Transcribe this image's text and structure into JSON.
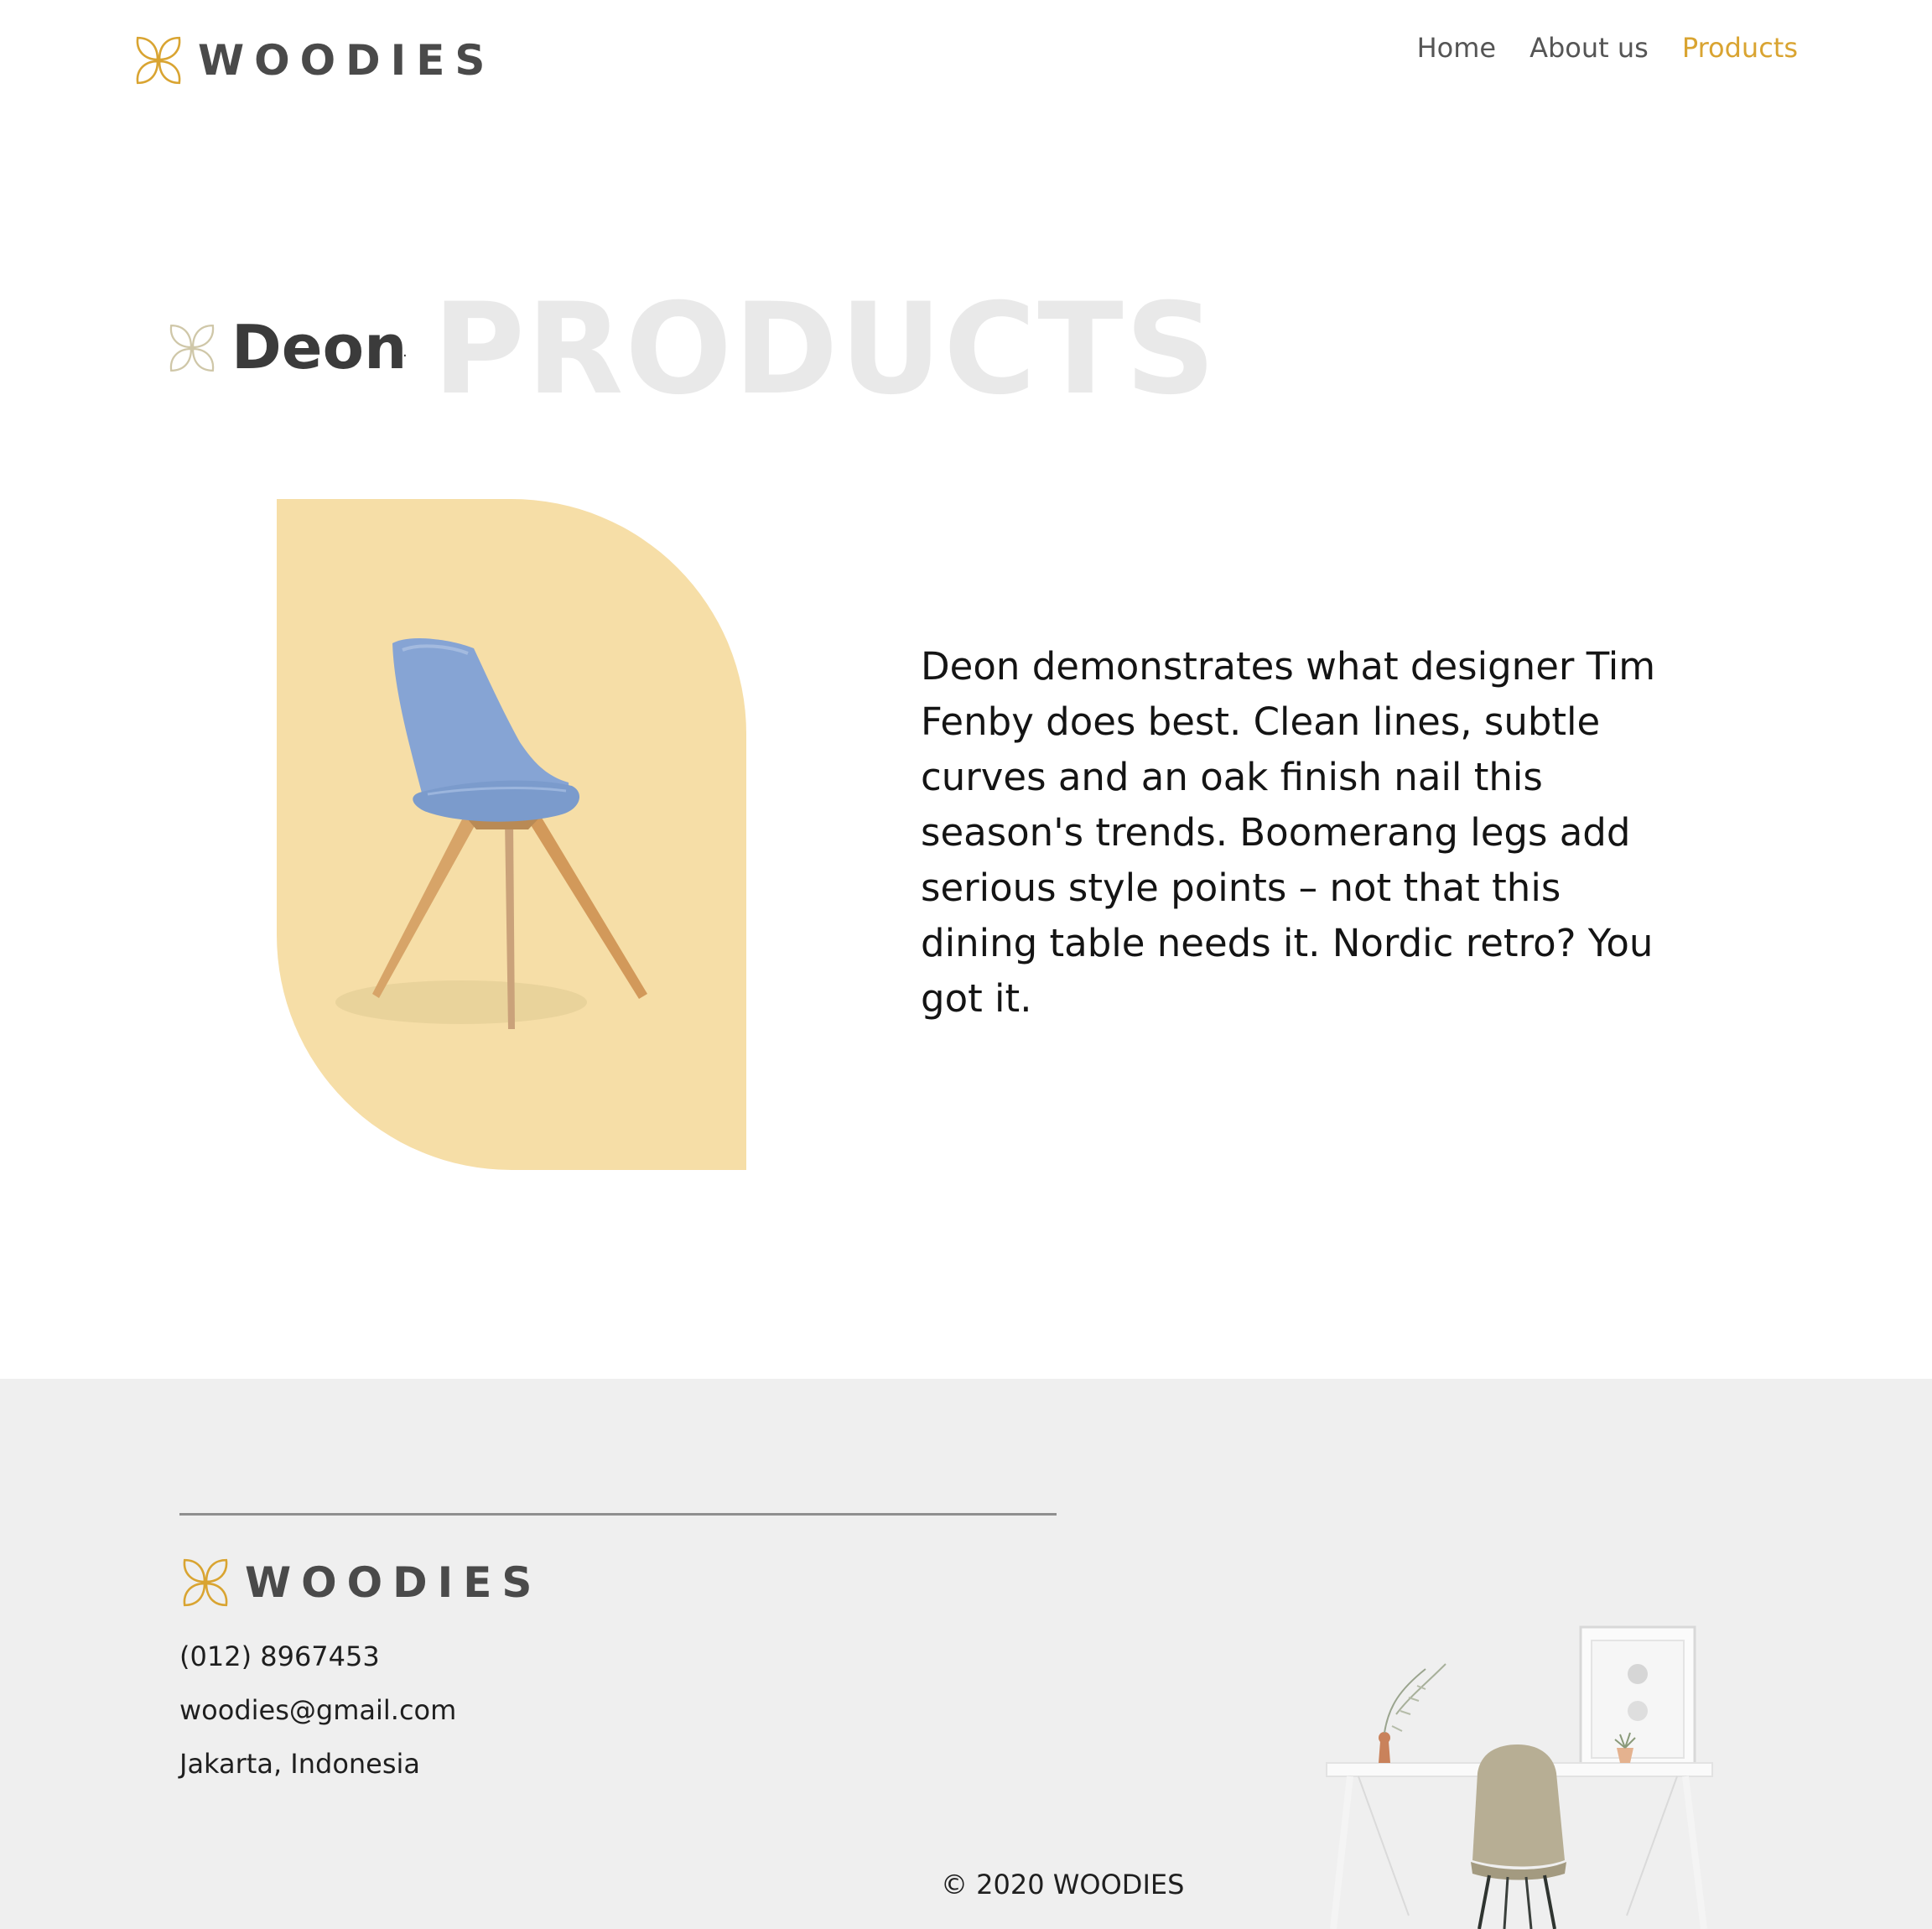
{
  "brand": {
    "name": "WOODIES",
    "accent_color": "#d9a431",
    "logo_icon": "four-petal-flower-icon"
  },
  "nav": {
    "items": [
      {
        "label": "Home",
        "active": false
      },
      {
        "label": "About us",
        "active": false
      },
      {
        "label": "Products",
        "active": true
      }
    ]
  },
  "product": {
    "name": "Deon",
    "section_watermark": "PRODUCTS",
    "card_color": "#f6dea7",
    "chair_color": "#7f9fd1",
    "description": "Deon demonstrates what designer Tim Fenby does best. Clean lines, subtle curves and an oak finish nail this season's trends. Boomerang legs add serious style points – not that this dining table needs it. Nordic retro? You got it."
  },
  "footer": {
    "brand": "WOODIES",
    "phone": "(012) 8967453",
    "email": "woodies@gmail.com",
    "location": "Jakarta, Indonesia",
    "copyright": "© 2020 WOODIES"
  }
}
